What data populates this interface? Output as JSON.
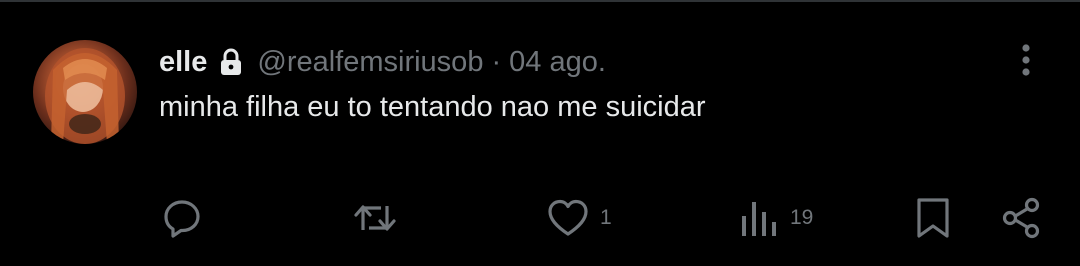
{
  "tweet": {
    "display_name": "elle",
    "handle": "@realfemsiriusob",
    "separator": "·",
    "date": "04 ago.",
    "text": "minha filha eu to tentando nao me suicidar",
    "protected_icon": "lock-icon",
    "more_icon": "more-vertical-icon"
  },
  "actions": {
    "reply": {
      "icon": "reply-icon"
    },
    "retweet": {
      "icon": "retweet-icon"
    },
    "like": {
      "icon": "heart-icon",
      "count": "1"
    },
    "views": {
      "icon": "views-icon",
      "count": "19"
    },
    "bookmark": {
      "icon": "bookmark-icon"
    },
    "share": {
      "icon": "share-icon"
    }
  },
  "colors": {
    "background": "#000000",
    "primary_text": "#e7e9ea",
    "secondary_text": "#71767b",
    "divider": "#2f3336"
  }
}
